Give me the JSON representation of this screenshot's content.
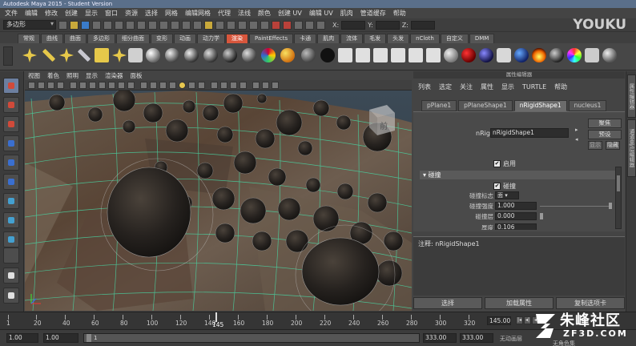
{
  "window": {
    "title": "Autodesk Maya 2015 - Student Version"
  },
  "menubar": [
    "文件",
    "编辑",
    "修改",
    "创建",
    "显示",
    "窗口",
    "资源",
    "选择",
    "网格",
    "编辑网格",
    "代理",
    "法线",
    "颜色",
    "创建 UV",
    "编辑 UV",
    "肌肉",
    "管道缓存",
    "帮助"
  ],
  "statusline": {
    "mode": "多边形",
    "coord_labels": [
      "X:",
      "Y:",
      "Z:"
    ]
  },
  "watermark_top": "YOUKU",
  "shelf_tabs": [
    {
      "label": "常规",
      "active": false
    },
    {
      "label": "曲线",
      "active": false
    },
    {
      "label": "曲面",
      "active": false
    },
    {
      "label": "多边形",
      "active": false
    },
    {
      "label": "细分曲面",
      "active": false
    },
    {
      "label": "变形",
      "active": false
    },
    {
      "label": "动画",
      "active": false
    },
    {
      "label": "动力学",
      "active": false
    },
    {
      "label": "渲染",
      "active": true
    },
    {
      "label": "PaintEffects",
      "active": false
    },
    {
      "label": "卡通",
      "active": false
    },
    {
      "label": "肌肉",
      "active": false
    },
    {
      "label": "流体",
      "active": false
    },
    {
      "label": "毛发",
      "active": false
    },
    {
      "label": "头发",
      "active": false
    },
    {
      "label": "nCloth",
      "active": false
    },
    {
      "label": "自定义",
      "active": false
    },
    {
      "label": "DMM",
      "active": false
    }
  ],
  "viewport_menu": [
    "视图",
    "着色",
    "照明",
    "显示",
    "渲染器",
    "面板"
  ],
  "viewport": {
    "cube_label": "前"
  },
  "attribute_editor": {
    "title": "属性编辑器",
    "menu": [
      "列表",
      "选定",
      "关注",
      "属性",
      "显示",
      "TURTLE",
      "帮助"
    ],
    "tabs": [
      {
        "label": "pPlane1",
        "active": false
      },
      {
        "label": "pPlaneShape1",
        "active": false
      },
      {
        "label": "nRigidShape1",
        "active": true
      },
      {
        "label": "nucleus1",
        "active": false
      }
    ],
    "node_label": "nRigid:",
    "node_value": "nRigidShape1",
    "focus_btn": "聚焦",
    "preset_btn": "预设",
    "show_btn": "显示",
    "hide_btn": "隐藏",
    "enable_label": "启用",
    "section": "碰撞",
    "collide_label": "碰撞",
    "collide_flag_label": "碰撞标志",
    "collide_flag_value": "面",
    "collide_strength_label": "碰撞强度",
    "collide_strength_value": "1.000",
    "collide_layer_label": "碰撞层",
    "collide_layer_value": "0.000",
    "thickness_label": "厚度",
    "thickness_value": "0.106",
    "notes_label": "注释: nRigidShape1",
    "buttons": [
      "选择",
      "加载属性",
      "复制选项卡"
    ]
  },
  "side_tabs": [
    "属性编辑器",
    "通道盒/层编辑器"
  ],
  "timeline": {
    "ticks": [
      "1",
      "20",
      "40",
      "60",
      "80",
      "100",
      "120",
      "140",
      "160",
      "180",
      "200",
      "220",
      "240",
      "260",
      "280",
      "300",
      "320"
    ],
    "current_frame_marker": "145",
    "current_frame_field": "145.00"
  },
  "range": {
    "start": "1.00",
    "anim_start": "1.00",
    "slider_value": "1",
    "end": "333.00",
    "anim_end": "333.00",
    "auto_key": "无动画层",
    "char_set": "无角色集"
  },
  "watermark_bottom": {
    "cn": "朱峰社区",
    "en": "ZF3D.COM"
  }
}
